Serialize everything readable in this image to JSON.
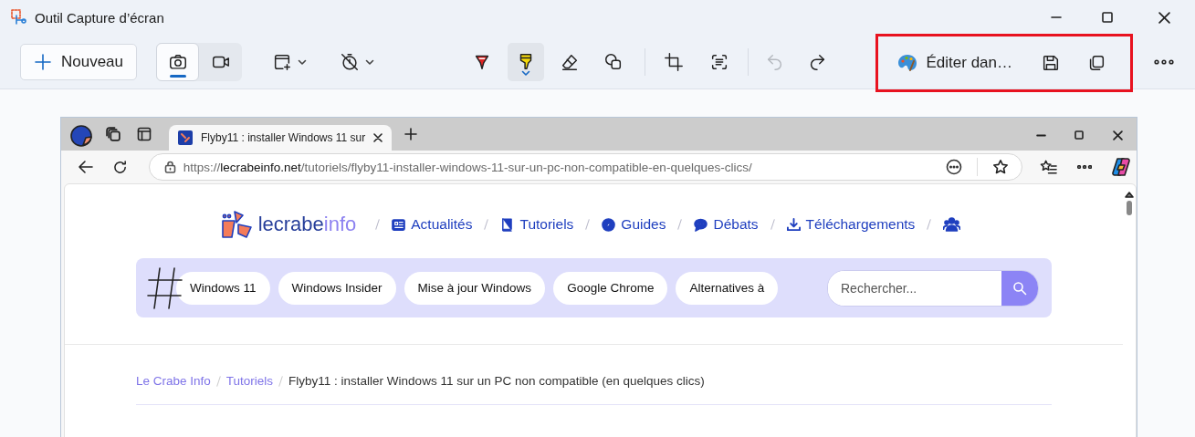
{
  "window": {
    "title": "Outil Capture d’écran"
  },
  "toolbar": {
    "new_label": "Nouveau",
    "capture_modes": [
      {
        "kind": "screenshot",
        "selected": true
      },
      {
        "kind": "video",
        "selected": false
      }
    ],
    "capture_options": [
      {
        "kind": "snip-mode"
      },
      {
        "kind": "timer"
      }
    ],
    "draw_tools": [
      {
        "kind": "pen",
        "selected": false
      },
      {
        "kind": "highlighter",
        "selected": true
      },
      {
        "kind": "eraser",
        "selected": false
      },
      {
        "kind": "shapes",
        "selected": false
      }
    ],
    "edit_tools": [
      {
        "kind": "crop"
      },
      {
        "kind": "text-actions"
      }
    ],
    "history": [
      {
        "kind": "undo",
        "disabled": true
      },
      {
        "kind": "redo",
        "disabled": false
      }
    ],
    "share": {
      "edit_label": "Éditer dan…"
    }
  },
  "browser": {
    "tabs": [
      {
        "title": "Flyby11 : installer Windows 11 sur",
        "selected": true
      }
    ],
    "url": {
      "scheme": "https://",
      "domain": "lecrabeinfo.net",
      "path": "/tutoriels/flyby11-installer-windows-11-sur-un-pc-non-compatible-en-quelques-clics/"
    }
  },
  "site": {
    "logo": [
      "lecrabe",
      "info"
    ],
    "nav": [
      {
        "kind": "news",
        "label": "Actualités"
      },
      {
        "kind": "book",
        "label": "Tutoriels"
      },
      {
        "kind": "compass",
        "label": "Guides"
      },
      {
        "kind": "chat",
        "label": "Débats"
      },
      {
        "kind": "download",
        "label": "Téléchargements"
      },
      {
        "kind": "people"
      }
    ],
    "tags": [
      "Windows 11",
      "Windows Insider",
      "Mise à jour Windows",
      "Google Chrome",
      "Alternatives à"
    ],
    "search": {
      "placeholder": "Rechercher..."
    },
    "breadcrumb": [
      {
        "kind": "link",
        "label": "Le Crabe Info"
      },
      {
        "kind": "link",
        "label": "Tutoriels"
      },
      {
        "kind": "current",
        "label": "Flyby11 : installer Windows 11 sur un PC non compatible (en quelques clics)"
      }
    ]
  }
}
